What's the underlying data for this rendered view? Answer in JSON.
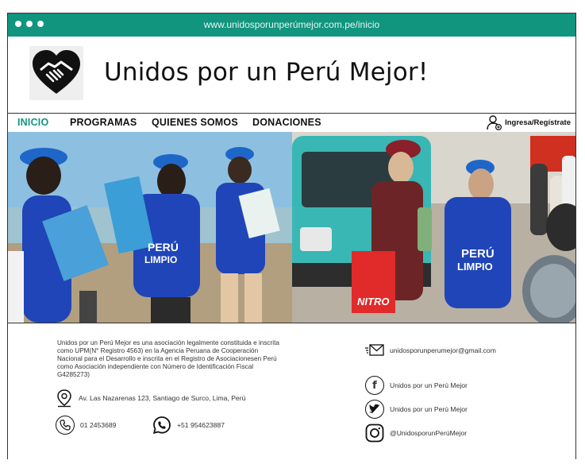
{
  "browser": {
    "url": "www.unidosporunperúmejor.com.pe/inicio",
    "accent_color": "#11957f"
  },
  "header": {
    "logo_icon": "handshake-heart-icon",
    "title": "Unidos por un Perú Mejor!"
  },
  "nav": {
    "items": [
      {
        "label": "INICIO",
        "active": true
      },
      {
        "label": "PROGRAMAS",
        "active": false
      },
      {
        "label": "QUIENES SOMOS",
        "active": false
      },
      {
        "label": "DONACIONES",
        "active": false
      }
    ],
    "login_label": "Ingresa/Regístrate"
  },
  "hero": {
    "left_vest_text": [
      "PERÚ",
      "LIMPIO"
    ],
    "right_vest_text": [
      "PERÚ",
      "LIMPIO"
    ],
    "bag_text": "NITRO"
  },
  "footer": {
    "about": "Unidos por un Perú Mejor es una asociación legalmente constituida e inscrita como UPM(N° Registro 4563) en la Agencia Peruana de Cooperación Nacional para el Desarrollo e inscrita en el Registro de Asociacionesen Perú como Asociación independiente con Número de Identificación Fiscal G4285273)",
    "address": "Av. Las Nazarenas 123, Santiago de Surco, Lima, Perú",
    "phone": "01 2453689",
    "whatsapp": "+51 954623887",
    "email": "unidosporunperumejor@gmail.com",
    "facebook": "Unidos por un Perú Mejor",
    "twitter": "Unidos por un Perú Mejor",
    "instagram": "@UnidosporunPerúMejor"
  }
}
